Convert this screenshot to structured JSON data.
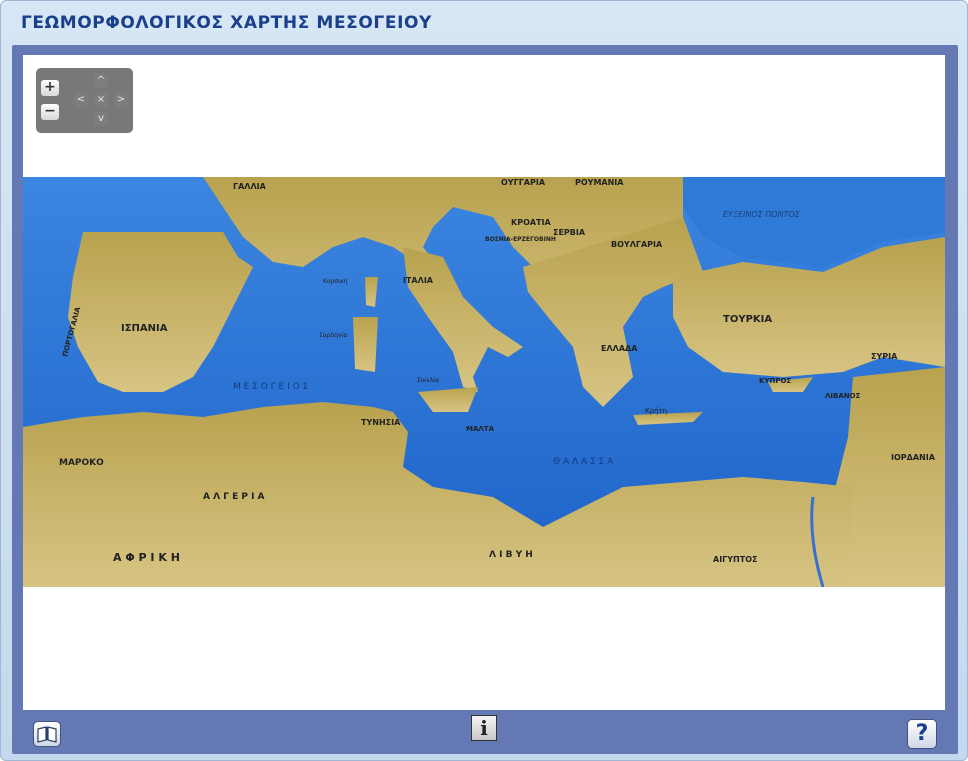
{
  "window": {
    "title": "ΓΕΩΜΟΡΦΟΛΟΓΙΚΟΣ ΧΑΡΤΗΣ ΜΕΣΟΓΕΙΟΥ"
  },
  "nav": {
    "zoom_in": "+",
    "zoom_out": "−",
    "pan_up": "^",
    "pan_down": "v",
    "pan_left": "<",
    "pan_right": ">",
    "reset": "×"
  },
  "map": {
    "labels": {
      "gallia": "ΓΑΛΛΙΑ",
      "oungaria": "ΟΥΓΓΑΡΙΑ",
      "roumania": "ΡΟΥΜΑΝΙΑ",
      "kroatia": "ΚΡΟΑΤΙΑ",
      "bosnia": "ΒΟΣΝΙΑ-ΕΡΖΕΓΟΒΙΝΗ",
      "servia": "ΣΕΡΒΙΑ",
      "voulgaria": "ΒΟΥΛΓΑΡΙΑ",
      "euxeinos": "ΕΥΞΕΙΝΟΣ ΠΟΝΤΟΣ",
      "italia": "ΙΤΑΛΙΑ",
      "portogalia": "ΠΟΡΤΟΓΑΛΙΑ",
      "ispania": "ΙΣΠΑΝΙΑ",
      "tourkia": "ΤΟΥΡΚΙΑ",
      "ellada": "ΕΛΛΑΔΑ",
      "kypros": "ΚΥΠΡΟΣ",
      "syria": "ΣΥΡΙΑ",
      "livanos": "ΛΙΒΑΝΟΣ",
      "iordania": "ΙΟΡΔΑΝΙΑ",
      "kriti": "Κρήτη",
      "malta": "ΜΑΛΤΑ",
      "maroko": "ΜΑΡΟΚΟ",
      "tynisia": "ΤΥΝΗΣΙΑ",
      "algeria": "Α Λ Γ Ε Ρ Ι Α",
      "livyi": "Λ Ι Β Υ Η",
      "aigyptos": "ΑΙΓΥΠΤΟΣ",
      "afriki": "Α    Φ    Ρ    Ι    Κ    Η",
      "mesogeios": "Μ  Ε  Σ  Ο  Γ  Ε  Ι  Ο  Σ",
      "thalassa": "Θ  Α  Λ  Α  Σ  Σ  Α",
      "korsiki": "Κορσική",
      "sardinia": "Σαρδηνία",
      "sikelia": "Σικελία"
    }
  },
  "bottom_bar": {
    "info_label": "i",
    "help_label": "?"
  },
  "colors": {
    "title": "#1a3f8c",
    "frame": "#6478b3",
    "sea": "#2a72d4",
    "land": "#c9b46a"
  }
}
